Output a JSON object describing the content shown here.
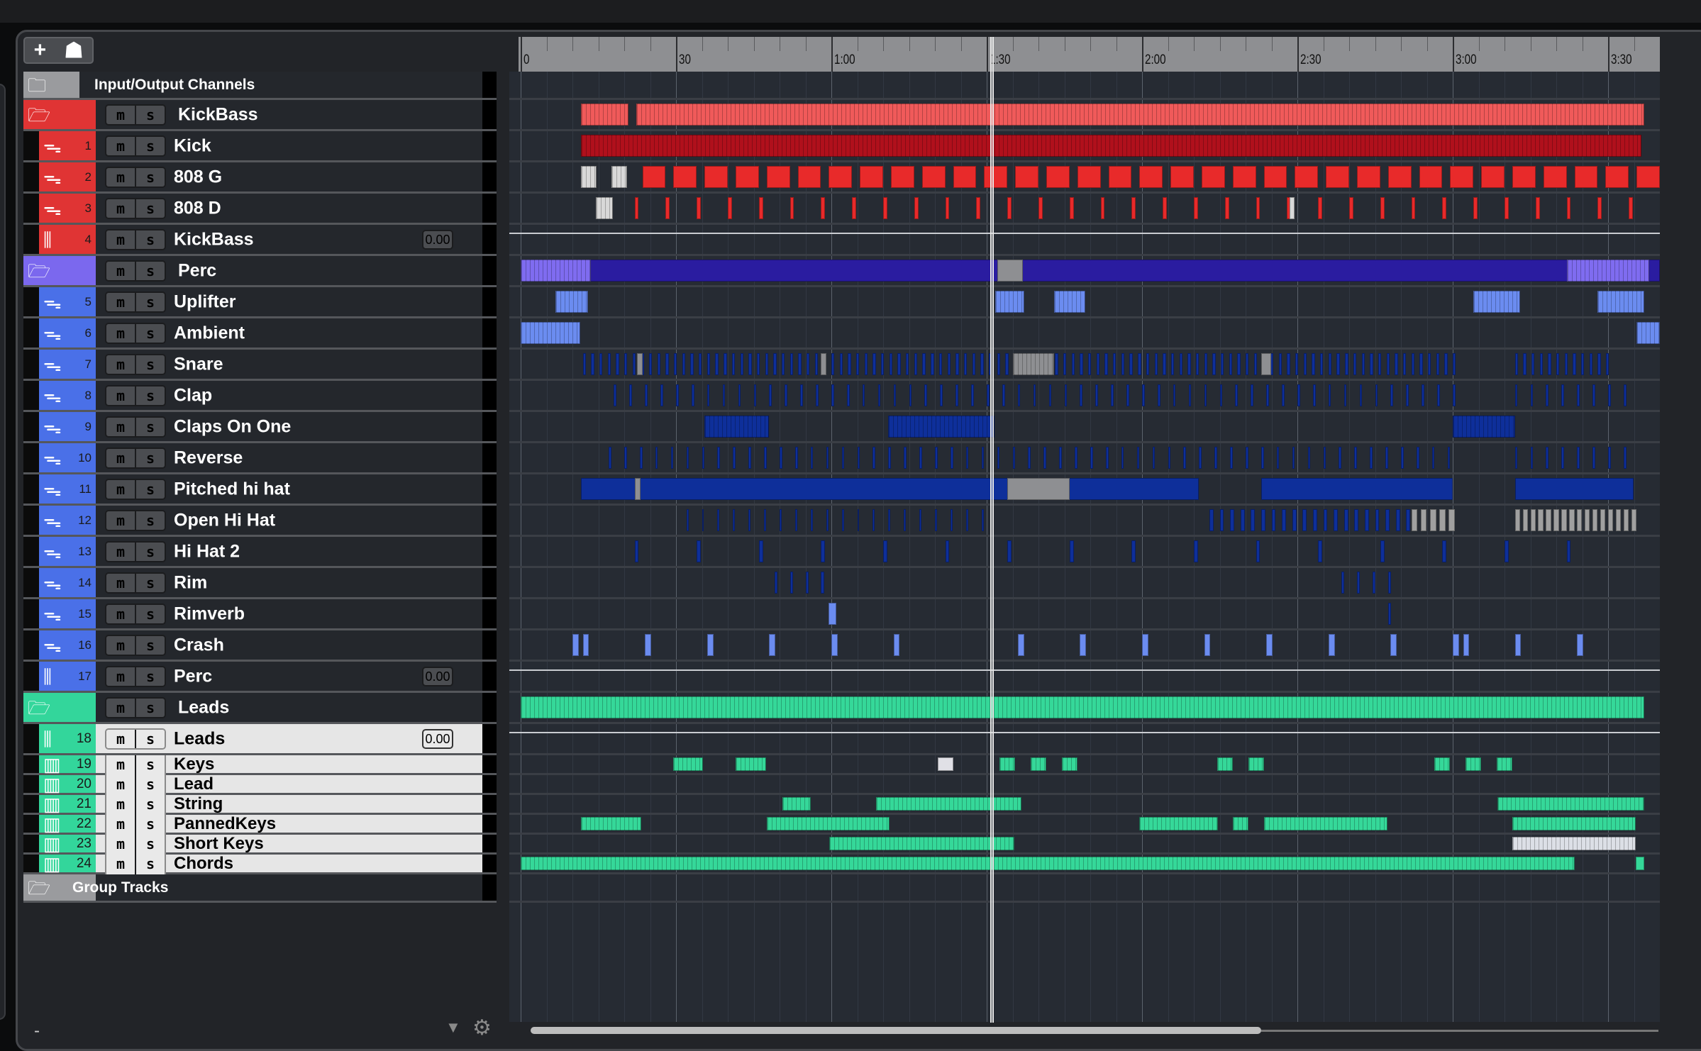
{
  "toolbar": {
    "add_icon": "+",
    "visibility_icon": "☗"
  },
  "ruler": {
    "labels": [
      {
        "t": 0,
        "text": "0"
      },
      {
        "t": 30,
        "text": "30"
      },
      {
        "t": 60,
        "text": "1:00"
      },
      {
        "t": 90,
        "text": "1:30"
      },
      {
        "t": 120,
        "text": "2:00"
      },
      {
        "t": 150,
        "text": "2:30"
      },
      {
        "t": 180,
        "text": "3:00"
      },
      {
        "t": 210,
        "text": "3:30"
      }
    ],
    "length_seconds": 220
  },
  "playhead_seconds": 91,
  "colors": {
    "red": "#e03434",
    "purple": "#7b68ee",
    "blue": "#4a70e8",
    "green": "#33d69b",
    "gray": "#9a9b9e"
  },
  "tracks": [
    {
      "type": "io",
      "name": "Input/Output Channels",
      "color": "#9a9b9e"
    },
    {
      "type": "folder",
      "name": "KickBass",
      "color": "#e03434",
      "m": "m",
      "s": "s",
      "clips": [
        [
          11.7,
          20.8,
          "#f05a5a",
          1
        ],
        [
          22.3,
          217,
          "#f05a5a",
          1
        ]
      ]
    },
    {
      "type": "audio",
      "number": "1",
      "name": "Kick",
      "color": "#e03434",
      "m": "m",
      "s": "s",
      "clips": [
        [
          11.7,
          216.5,
          "#b0101c",
          1
        ]
      ]
    },
    {
      "type": "audio",
      "number": "2",
      "name": "808 G",
      "color": "#e03434",
      "m": "m",
      "s": "s",
      "clips": [
        [
          11.7,
          14.7,
          "#d8d8d8",
          1
        ],
        [
          17.6,
          20.6,
          "#d8d8d8",
          1
        ]
      ],
      "ticks": [
        [
          23.5,
          216,
          6,
          4.5,
          "#e82a2a"
        ]
      ]
    },
    {
      "type": "audio",
      "number": "3",
      "name": "808 D",
      "color": "#e03434",
      "m": "m",
      "s": "s",
      "clips": [
        [
          14.5,
          17.8,
          "#d8d8d8",
          1
        ],
        [
          148.5,
          149.5,
          "#d8d8d8",
          0
        ]
      ],
      "ticks": [
        [
          22,
          214,
          6,
          0.8,
          "#e82a2a"
        ]
      ]
    },
    {
      "type": "group",
      "number": "4",
      "name": "KickBass",
      "color": "#e03434",
      "m": "m",
      "s": "s",
      "value": "0.00"
    },
    {
      "type": "folder",
      "name": "Perc",
      "color": "#7b68ee",
      "m": "m",
      "s": "s",
      "clips": [
        [
          0,
          220,
          "#2a1ca0",
          0
        ],
        [
          0,
          13.5,
          "#7f6cf0",
          1
        ],
        [
          92,
          97,
          "#8e8f92",
          0
        ],
        [
          202,
          218,
          "#7f6cf0",
          1
        ]
      ],
      "ticks": [
        [
          2,
          218,
          3,
          0.5,
          "#9a88ff"
        ]
      ]
    },
    {
      "type": "audio",
      "number": "5",
      "name": "Uplifter",
      "color": "#4a70e8",
      "m": "m",
      "s": "s",
      "clips": [
        [
          6.7,
          13,
          "#6b8cf0",
          1
        ],
        [
          91.7,
          97.3,
          "#6b8cf0",
          1
        ],
        [
          103,
          109,
          "#6b8cf0",
          1
        ],
        [
          184,
          193,
          "#6b8cf0",
          1
        ],
        [
          208,
          217,
          "#6b8cf0",
          1
        ]
      ]
    },
    {
      "type": "audio",
      "number": "6",
      "name": "Ambient",
      "color": "#4a70e8",
      "m": "m",
      "s": "s",
      "clips": [
        [
          0,
          11.5,
          "#6b8cf0",
          1
        ],
        [
          215.5,
          220,
          "#6b8cf0",
          1
        ]
      ]
    },
    {
      "type": "audio",
      "number": "7",
      "name": "Snare",
      "color": "#4a70e8",
      "m": "m",
      "s": "s",
      "ticks": [
        [
          12,
          180,
          1.6,
          0.6,
          "#0e2f9a"
        ],
        [
          192,
          210,
          1.6,
          0.6,
          "#0e2f9a"
        ]
      ],
      "clips": [
        [
          22.5,
          23.5,
          "#8e8f92",
          0
        ],
        [
          58,
          59,
          "#8e8f92",
          0
        ],
        [
          95,
          103,
          "#8e8f92",
          1
        ],
        [
          143,
          145,
          "#8e8f92",
          0
        ]
      ]
    },
    {
      "type": "audio",
      "number": "8",
      "name": "Clap",
      "color": "#4a70e8",
      "m": "m",
      "s": "s",
      "ticks": [
        [
          18,
          180,
          3,
          0.5,
          "#0e2f9a"
        ],
        [
          192,
          214,
          3,
          0.5,
          "#0e2f9a"
        ]
      ]
    },
    {
      "type": "audio",
      "number": "9",
      "name": "Claps On One",
      "color": "#4a70e8",
      "m": "m",
      "s": "s",
      "clips": [
        [
          35.5,
          48,
          "#0e2f9a",
          1
        ],
        [
          71,
          91.5,
          "#0e2f9a",
          1
        ],
        [
          180,
          192,
          "#0e2f9a",
          1
        ]
      ]
    },
    {
      "type": "audio",
      "number": "10",
      "name": "Reverse",
      "color": "#4a70e8",
      "m": "m",
      "s": "s",
      "ticks": [
        [
          17,
          180,
          3,
          0.5,
          "#0e2f9a"
        ],
        [
          192,
          214,
          3,
          0.5,
          "#0e2f9a"
        ]
      ]
    },
    {
      "type": "audio",
      "number": "11",
      "name": "Pitched hi hat",
      "color": "#4a70e8",
      "m": "m",
      "s": "s",
      "clips": [
        [
          11.7,
          131,
          "#0e2f9a",
          0
        ],
        [
          22,
          23.2,
          "#8e8f92",
          0
        ],
        [
          94,
          106,
          "#8e8f92",
          0
        ],
        [
          143,
          180,
          "#0e2f9a",
          0
        ],
        [
          192,
          215,
          "#0e2f9a",
          0
        ]
      ]
    },
    {
      "type": "audio",
      "number": "12",
      "name": "Open Hi Hat",
      "color": "#4a70e8",
      "m": "m",
      "s": "s",
      "ticks": [
        [
          32,
          90,
          3,
          0.4,
          "#0e2f9a"
        ],
        [
          133,
          172,
          2,
          0.8,
          "#0e2f9a"
        ],
        [
          172,
          180,
          1.8,
          1.2,
          "#a0a0a0"
        ],
        [
          192,
          215,
          1.5,
          1,
          "#a0a0a0"
        ]
      ]
    },
    {
      "type": "audio",
      "number": "13",
      "name": "Hi Hat 2",
      "color": "#4a70e8",
      "m": "m",
      "s": "s",
      "ticks": [
        [
          22,
          206,
          12,
          0.8,
          "#0e2f9a"
        ]
      ]
    },
    {
      "type": "audio",
      "number": "14",
      "name": "Rim",
      "color": "#4a70e8",
      "m": "m",
      "s": "s",
      "clips": [
        [
          49,
          49.6,
          "#0e2f9a",
          0
        ],
        [
          52,
          52.6,
          "#0e2f9a",
          0
        ],
        [
          55,
          55.6,
          "#0e2f9a",
          0
        ],
        [
          58,
          58.6,
          "#0e2f9a",
          0
        ],
        [
          158.5,
          159.1,
          "#0e2f9a",
          0
        ],
        [
          161.5,
          162.1,
          "#0e2f9a",
          0
        ],
        [
          164.5,
          165.1,
          "#0e2f9a",
          0
        ],
        [
          167.5,
          168.1,
          "#0e2f9a",
          0
        ]
      ]
    },
    {
      "type": "audio",
      "number": "15",
      "name": "Rimverb",
      "color": "#4a70e8",
      "m": "m",
      "s": "s",
      "clips": [
        [
          59.5,
          61,
          "#6b8cf0",
          0
        ],
        [
          167.5,
          168.1,
          "#0e2f9a",
          0
        ]
      ]
    },
    {
      "type": "audio",
      "number": "16",
      "name": "Crash",
      "color": "#4a70e8",
      "m": "m",
      "s": "s",
      "clips": [
        [
          10,
          11.2,
          "#6b8cf0",
          0
        ],
        [
          12,
          13.2,
          "#6b8cf0",
          0
        ],
        [
          24,
          25.2,
          "#6b8cf0",
          0
        ],
        [
          36,
          37.2,
          "#6b8cf0",
          0
        ],
        [
          48,
          49.2,
          "#6b8cf0",
          0
        ],
        [
          60,
          61.2,
          "#6b8cf0",
          0
        ],
        [
          72,
          73.2,
          "#6b8cf0",
          0
        ],
        [
          96,
          97.2,
          "#6b8cf0",
          0
        ],
        [
          108,
          109.2,
          "#6b8cf0",
          0
        ],
        [
          120,
          121.2,
          "#6b8cf0",
          0
        ],
        [
          132,
          133.2,
          "#6b8cf0",
          0
        ],
        [
          144,
          145.2,
          "#6b8cf0",
          0
        ],
        [
          156,
          157.2,
          "#6b8cf0",
          0
        ],
        [
          168,
          169.2,
          "#6b8cf0",
          0
        ],
        [
          180,
          181.2,
          "#6b8cf0",
          0
        ],
        [
          182,
          183.2,
          "#6b8cf0",
          0
        ],
        [
          192,
          193.2,
          "#6b8cf0",
          0
        ],
        [
          204,
          205.2,
          "#6b8cf0",
          0
        ]
      ]
    },
    {
      "type": "group",
      "number": "17",
      "name": "Perc",
      "color": "#4a70e8",
      "m": "m",
      "s": "s",
      "value": "0.00"
    },
    {
      "type": "folder",
      "name": "Leads",
      "color": "#33d69b",
      "m": "m",
      "s": "s",
      "clips": [
        [
          0,
          217,
          "#35d899",
          1
        ]
      ]
    },
    {
      "type": "group",
      "number": "18",
      "name": "Leads",
      "color": "#33d69b",
      "m": "m",
      "s": "s",
      "value": "0.00",
      "selected": true
    },
    {
      "type": "instrument",
      "number": "19",
      "name": "Keys",
      "color": "#33d69b",
      "m": "m",
      "s": "s",
      "selected": true,
      "clips": [
        [
          29.4,
          35.2,
          "#35d899",
          1
        ],
        [
          41.5,
          47.4,
          "#35d899",
          1
        ],
        [
          80.5,
          83.5,
          "#e0e0e6",
          0
        ],
        [
          92.5,
          95.5,
          "#35d899",
          1
        ],
        [
          98.5,
          101.5,
          "#35d899",
          1
        ],
        [
          104.5,
          107.5,
          "#35d899",
          1
        ],
        [
          134.5,
          137.5,
          "#35d899",
          1
        ],
        [
          140.5,
          143.5,
          "#35d899",
          1
        ],
        [
          176.5,
          179.5,
          "#35d899",
          1
        ],
        [
          182.5,
          185.5,
          "#35d899",
          1
        ],
        [
          188.5,
          191.5,
          "#35d899",
          1
        ]
      ]
    },
    {
      "type": "instrument",
      "number": "20",
      "name": "Lead",
      "color": "#33d69b",
      "m": "m",
      "s": "s",
      "selected": true
    },
    {
      "type": "instrument",
      "number": "21",
      "name": "String",
      "color": "#33d69b",
      "m": "m",
      "s": "s",
      "selected": true,
      "clips": [
        [
          50.5,
          56,
          "#35d899",
          1
        ],
        [
          68.6,
          96.7,
          "#35d899",
          1
        ],
        [
          188.6,
          217,
          "#35d899",
          1
        ]
      ]
    },
    {
      "type": "instrument",
      "number": "22",
      "name": "PannedKeys",
      "color": "#33d69b",
      "m": "m",
      "s": "s",
      "selected": true,
      "clips": [
        [
          11.7,
          23.3,
          "#35d899",
          1
        ],
        [
          47.6,
          71.3,
          "#35d899",
          1
        ],
        [
          119.4,
          134.7,
          "#35d899",
          1
        ],
        [
          137.6,
          140.5,
          "#35d899",
          1
        ],
        [
          143.5,
          167.4,
          "#35d899",
          1
        ],
        [
          191.5,
          215.4,
          "#35d899",
          1
        ]
      ]
    },
    {
      "type": "instrument",
      "number": "23",
      "name": "Short Keys",
      "color": "#33d69b",
      "m": "m",
      "s": "s",
      "selected": true,
      "clips": [
        [
          59.6,
          95.4,
          "#35d899",
          1
        ],
        [
          191.5,
          215.4,
          "#dcdfe6",
          1
        ]
      ]
    },
    {
      "type": "instrument",
      "number": "24",
      "name": "Chords",
      "color": "#33d69b",
      "m": "m",
      "s": "s",
      "selected": true,
      "clips": [
        [
          0,
          203.5,
          "#35d899",
          1
        ],
        [
          215.4,
          217,
          "#35d899",
          0
        ]
      ]
    },
    {
      "type": "groupfolder",
      "name": "Group Tracks",
      "color": "#9a9b9e"
    }
  ],
  "footer": {
    "minus": "-",
    "dropdown_icon": "▼",
    "settings_icon": "⚙"
  }
}
